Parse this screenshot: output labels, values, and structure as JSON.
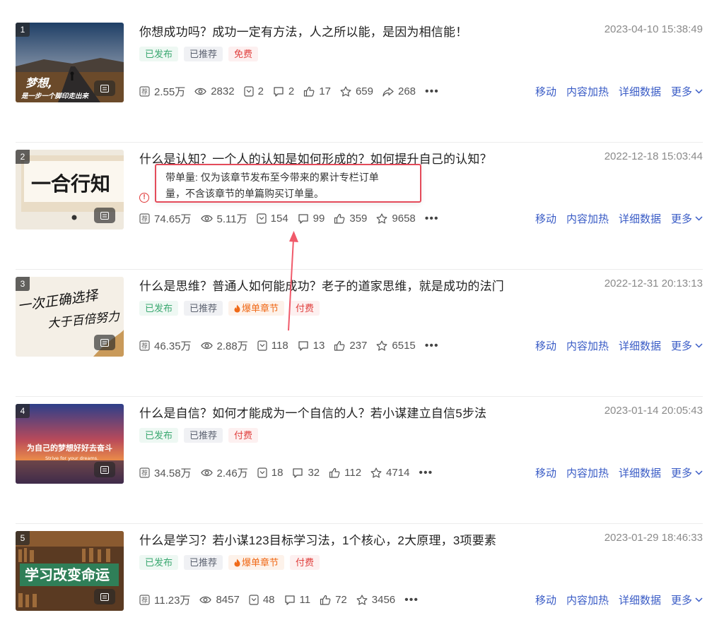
{
  "articles": [
    {
      "rank": "1",
      "title": "你想成功吗？成功一定有方法，人之所以能，是因为相信能！",
      "date": "2023-04-10 15:38:49",
      "tags": [
        {
          "label": "已发布",
          "style": "green"
        },
        {
          "label": "已推荐",
          "style": "gray"
        },
        {
          "label": "免费",
          "style": "red"
        }
      ],
      "thumb_text": [
        "梦想,",
        "是一步一个脚印走出来"
      ],
      "stats": {
        "recommend": "2.55万",
        "views": "2832",
        "orders": "2",
        "comments": "2",
        "likes": "17",
        "favorites": "659",
        "shares": "268"
      }
    },
    {
      "rank": "2",
      "title": "什么是认知？一个人的认知是如何形成的？如何提升自己的认知？",
      "date": "2022-12-18 15:03:44",
      "tags": [],
      "thumb_text": [
        "一合行知"
      ],
      "stats": {
        "recommend": "74.65万",
        "views": "5.11万",
        "orders": "154",
        "comments": "99",
        "likes": "359",
        "favorites": "9658"
      }
    },
    {
      "rank": "3",
      "title": "什么是思维？普通人如何能成功？老子的道家思维，就是成功的法门",
      "date": "2022-12-31 20:13:13",
      "tags": [
        {
          "label": "已发布",
          "style": "green"
        },
        {
          "label": "已推荐",
          "style": "gray"
        },
        {
          "label": "爆单章节",
          "style": "orange"
        },
        {
          "label": "付费",
          "style": "red"
        }
      ],
      "thumb_text": [
        "一次正确选择",
        "大于百倍努力"
      ],
      "stats": {
        "recommend": "46.35万",
        "views": "2.88万",
        "orders": "118",
        "comments": "13",
        "likes": "237",
        "favorites": "6515"
      }
    },
    {
      "rank": "4",
      "title": "什么是自信？如何才能成为一个自信的人？若小谋建立自信5步法",
      "date": "2023-01-14 20:05:43",
      "tags": [
        {
          "label": "已发布",
          "style": "green"
        },
        {
          "label": "已推荐",
          "style": "gray"
        },
        {
          "label": "付费",
          "style": "red"
        }
      ],
      "thumb_text": [
        "为自己的梦想好好去奋斗",
        "Strive for your dreams."
      ],
      "stats": {
        "recommend": "34.58万",
        "views": "2.46万",
        "orders": "18",
        "comments": "32",
        "likes": "112",
        "favorites": "4714"
      }
    },
    {
      "rank": "5",
      "title": "什么是学习？若小谋123目标学习法，1个核心，2大原理，3项要素",
      "date": "2023-01-29 18:46:33",
      "tags": [
        {
          "label": "已发布",
          "style": "green"
        },
        {
          "label": "已推荐",
          "style": "gray"
        },
        {
          "label": "爆单章节",
          "style": "orange"
        },
        {
          "label": "付费",
          "style": "red"
        }
      ],
      "thumb_text": [
        "学习改变命运"
      ],
      "stats": {
        "recommend": "11.23万",
        "views": "8457",
        "orders": "48",
        "comments": "11",
        "likes": "72",
        "favorites": "3456"
      }
    }
  ],
  "actions": {
    "move": "移动",
    "boost": "内容加热",
    "detail": "详细数据",
    "more": "更多"
  },
  "tooltip": {
    "line1": "带单量: 仅为该章节发布至今带来的累计专栏订单",
    "line2": "量，不含该章节的单篇购买订单量。"
  },
  "icons": [
    "recommend-icon",
    "eye-icon",
    "order-icon",
    "comment-icon",
    "like-icon",
    "star-icon",
    "share-icon",
    "flame-icon",
    "doc-icon",
    "chevron-down-icon",
    "warning-icon"
  ],
  "colors": {
    "link": "#3a5cc6",
    "highlight_border": "#e44b5a",
    "green_tag": "#3aa870",
    "red_tag": "#e0403e",
    "orange_tag": "#f06a18"
  }
}
